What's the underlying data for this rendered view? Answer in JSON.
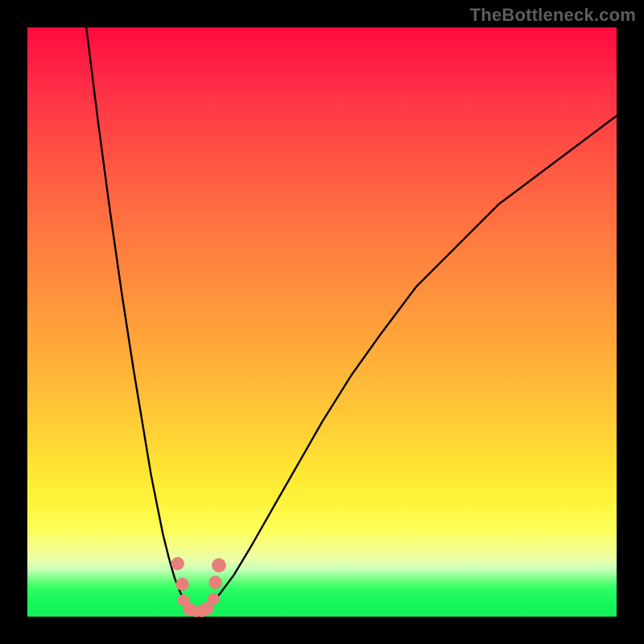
{
  "watermark": "TheBottleneck.com",
  "colors": {
    "bg": "#000000",
    "gradient_top": "#ff0a3e",
    "gradient_mid": "#ffe233",
    "gradient_bottom": "#12ef57",
    "curve": "#000000",
    "dots": "#e77f7a"
  },
  "chart_data": {
    "type": "line",
    "title": "",
    "xlabel": "",
    "ylabel": "",
    "xlim": [
      0,
      100
    ],
    "ylim": [
      0,
      100
    ],
    "series": [
      {
        "name": "left-curve",
        "x": [
          10,
          12,
          14,
          16,
          18,
          20,
          21,
          22,
          23,
          24,
          25,
          26,
          27,
          28
        ],
        "values": [
          100,
          84,
          69,
          55,
          42,
          30,
          24,
          19,
          14,
          10,
          6.5,
          4,
          2,
          0.8
        ]
      },
      {
        "name": "right-curve",
        "x": [
          30,
          32,
          35,
          38,
          42,
          46,
          50,
          55,
          60,
          66,
          72,
          80,
          88,
          96,
          100
        ],
        "values": [
          0.8,
          3,
          7,
          12,
          19,
          26,
          33,
          41,
          48,
          56,
          62,
          70,
          76,
          82,
          85
        ]
      }
    ],
    "flat_bottom": {
      "x_from": 28,
      "x_to": 30,
      "y": 0.7
    },
    "markers": [
      {
        "x": 25.5,
        "y": 9,
        "r": 1.1
      },
      {
        "x": 26.3,
        "y": 5.5,
        "r": 1.1
      },
      {
        "x": 26.5,
        "y": 2.8,
        "r": 1.0
      },
      {
        "x": 27.5,
        "y": 1.3,
        "r": 1.1
      },
      {
        "x": 28.6,
        "y": 0.9,
        "r": 1.0
      },
      {
        "x": 29.6,
        "y": 0.9,
        "r": 1.0
      },
      {
        "x": 30.5,
        "y": 1.4,
        "r": 1.1
      },
      {
        "x": 31.6,
        "y": 3.0,
        "r": 1.0
      },
      {
        "x": 31.9,
        "y": 5.8,
        "r": 1.1
      },
      {
        "x": 32.5,
        "y": 8.7,
        "r": 1.2
      }
    ],
    "legend": []
  }
}
